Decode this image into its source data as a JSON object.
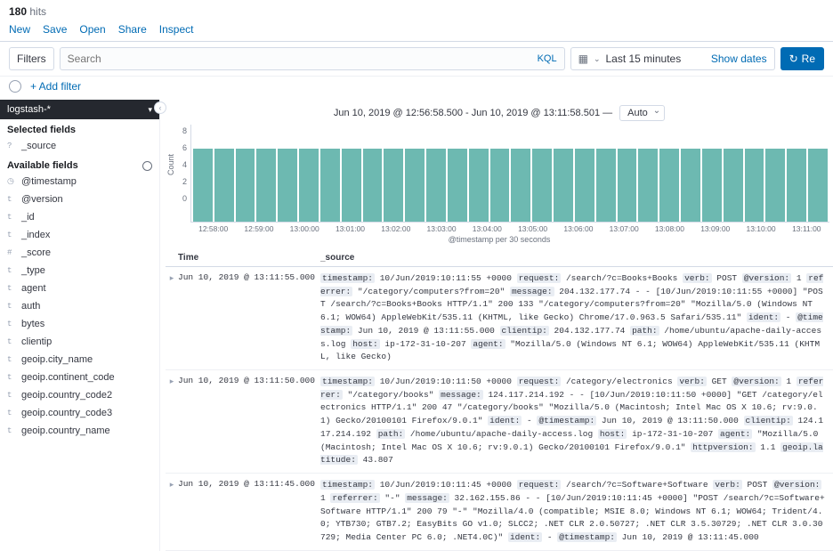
{
  "hits": {
    "count": "180",
    "label": "hits"
  },
  "menu": [
    "New",
    "Save",
    "Open",
    "Share",
    "Inspect"
  ],
  "filterbar": {
    "filters_label": "Filters",
    "search_placeholder": "Search",
    "kql": "KQL",
    "date_range": "Last 15 minutes",
    "show_dates": "Show dates",
    "refresh": "Re"
  },
  "addfilter": "+ Add filter",
  "sidebar": {
    "index_pattern": "logstash-*",
    "selected_header": "Selected fields",
    "selected": [
      {
        "type": "?",
        "name": "_source"
      }
    ],
    "available_header": "Available fields",
    "available": [
      {
        "type": "◷",
        "name": "@timestamp"
      },
      {
        "type": "t",
        "name": "@version"
      },
      {
        "type": "t",
        "name": "_id"
      },
      {
        "type": "t",
        "name": "_index"
      },
      {
        "type": "#",
        "name": "_score"
      },
      {
        "type": "t",
        "name": "_type"
      },
      {
        "type": "t",
        "name": "agent"
      },
      {
        "type": "t",
        "name": "auth"
      },
      {
        "type": "t",
        "name": "bytes"
      },
      {
        "type": "t",
        "name": "clientip"
      },
      {
        "type": "t",
        "name": "geoip.city_name"
      },
      {
        "type": "t",
        "name": "geoip.continent_code"
      },
      {
        "type": "t",
        "name": "geoip.country_code2"
      },
      {
        "type": "t",
        "name": "geoip.country_code3"
      },
      {
        "type": "t",
        "name": "geoip.country_name"
      }
    ]
  },
  "chart_title": "Jun 10, 2019 @ 12:56:58.500 - Jun 10, 2019 @ 13:11:58.501 —",
  "interval": "Auto",
  "chart_data": {
    "type": "bar",
    "ylabel": "Count",
    "xlabel": "@timestamp per 30 seconds",
    "ylim": [
      0,
      8
    ],
    "yticks": [
      "8",
      "6",
      "4",
      "2",
      "0"
    ],
    "categories": [
      "12:58:00",
      "12:59:00",
      "13:00:00",
      "13:01:00",
      "13:02:00",
      "13:03:00",
      "13:04:00",
      "13:05:00",
      "13:06:00",
      "13:07:00",
      "13:08:00",
      "13:09:00",
      "13:10:00",
      "13:11:00"
    ],
    "values": [
      6,
      6,
      6,
      6,
      6,
      6,
      6,
      6,
      6,
      6,
      6,
      6,
      6,
      6,
      6,
      6,
      6,
      6,
      6,
      6,
      6,
      6,
      6,
      6,
      6,
      6,
      6,
      6,
      6,
      6
    ]
  },
  "table": {
    "headers": {
      "time": "Time",
      "source": "_source"
    },
    "rows": [
      {
        "time": "Jun 10, 2019 @ 13:11:55.000",
        "source": "<span class='k'>timestamp:</span> 10/Jun/2019:10:11:55 +0000 <span class='k'>request:</span> /search/?c=Books+Books <span class='k'>verb:</span> POST <span class='k'>@version:</span> 1 <span class='k'>referrer:</span> \"/category/computers?from=20\" <span class='k'>message:</span> 204.132.177.74 - - [10/Jun/2019:10:11:55 +0000] \"POST /search/?c=Books+Books HTTP/1.1\" 200 133 \"/category/computers?from=20\" \"Mozilla/5.0 (Windows NT 6.1; WOW64) AppleWebKit/535.11 (KHTML, like Gecko) Chrome/17.0.963.5 Safari/535.11\" <span class='k'>ident:</span> - <span class='k'>@timestamp:</span> Jun 10, 2019 @ 13:11:55.000 <span class='k'>clientip:</span> 204.132.177.74 <span class='k'>path:</span> /home/ubuntu/apache-daily-access.log <span class='k'>host:</span> ip-172-31-10-207 <span class='k'>agent:</span> \"Mozilla/5.0 (Windows NT 6.1; WOW64) AppleWebKit/535.11 (KHTML, like Gecko)"
      },
      {
        "time": "Jun 10, 2019 @ 13:11:50.000",
        "source": "<span class='k'>timestamp:</span> 10/Jun/2019:10:11:50 +0000 <span class='k'>request:</span> /category/electronics <span class='k'>verb:</span> GET <span class='k'>@version:</span> 1 <span class='k'>referrer:</span> \"/category/books\" <span class='k'>message:</span> 124.117.214.192 - - [10/Jun/2019:10:11:50 +0000] \"GET /category/electronics HTTP/1.1\" 200 47 \"/category/books\" \"Mozilla/5.0 (Macintosh; Intel Mac OS X 10.6; rv:9.0.1) Gecko/20100101 Firefox/9.0.1\" <span class='k'>ident:</span> - <span class='k'>@timestamp:</span> Jun 10, 2019 @ 13:11:50.000 <span class='k'>clientip:</span> 124.117.214.192 <span class='k'>path:</span> /home/ubuntu/apache-daily-access.log <span class='k'>host:</span> ip-172-31-10-207 <span class='k'>agent:</span> \"Mozilla/5.0 (Macintosh; Intel Mac OS X 10.6; rv:9.0.1) Gecko/20100101 Firefox/9.0.1\" <span class='k'>httpversion:</span> 1.1 <span class='k'>geoip.latitude:</span> 43.807"
      },
      {
        "time": "Jun 10, 2019 @ 13:11:45.000",
        "source": "<span class='k'>timestamp:</span> 10/Jun/2019:10:11:45 +0000 <span class='k'>request:</span> /search/?c=Software+Software <span class='k'>verb:</span> POST <span class='k'>@version:</span> 1 <span class='k'>referrer:</span> \"-\" <span class='k'>message:</span> 32.162.155.86 - - [10/Jun/2019:10:11:45 +0000] \"POST /search/?c=Software+Software HTTP/1.1\" 200 79 \"-\" \"Mozilla/4.0 (compatible; MSIE 8.0; Windows NT 6.1; WOW64; Trident/4.0; YTB730; GTB7.2; EasyBits GO v1.0; SLCC2; .NET CLR 2.0.50727; .NET CLR 3.5.30729; .NET CLR 3.0.30729; Media Center PC 6.0; .NET4.0C)\" <span class='k'>ident:</span> - <span class='k'>@timestamp:</span> Jun 10, 2019 @ 13:11:45.000"
      }
    ]
  }
}
